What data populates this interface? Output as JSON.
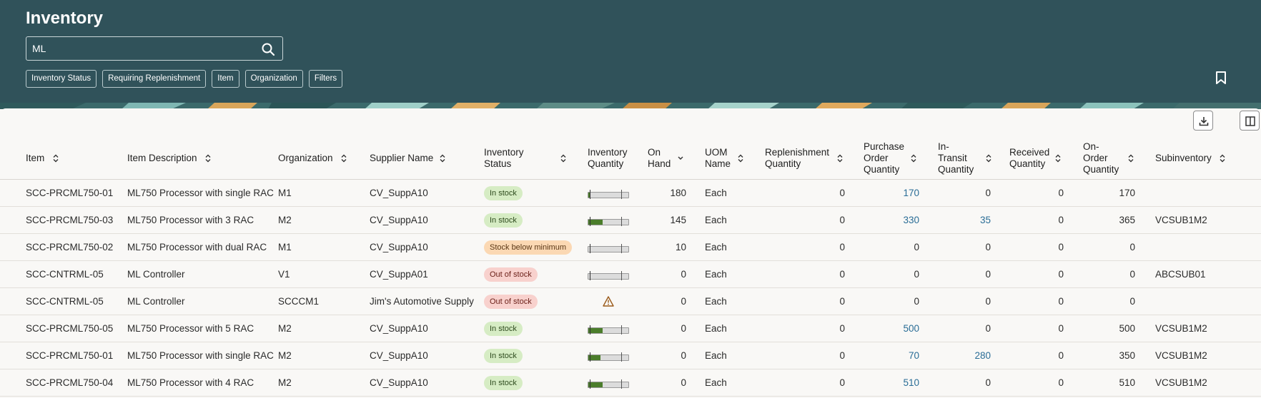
{
  "page": {
    "title": "Inventory"
  },
  "search": {
    "value": "ML"
  },
  "filters": [
    "Inventory Status",
    "Requiring Replenishment",
    "Item",
    "Organization",
    "Filters"
  ],
  "table": {
    "headers": {
      "item": [
        "Item"
      ],
      "description": [
        "Item Description"
      ],
      "organization": [
        "Organization"
      ],
      "supplier": [
        "Supplier Name"
      ],
      "status": [
        "Inventory",
        "Status"
      ],
      "inv_qty": [
        "Inventory",
        "Quantity"
      ],
      "on_hand": [
        "On",
        "Hand"
      ],
      "uom": [
        "UOM",
        "Name"
      ],
      "repl_qty": [
        "Replenishment",
        "Quantity"
      ],
      "po_qty": [
        "Purchase",
        "Order",
        "Quantity"
      ],
      "transit_qty": [
        "In-",
        "Transit",
        "Quantity"
      ],
      "received_qty": [
        "Received",
        "Quantity"
      ],
      "on_order_qty": [
        "On-",
        "Order",
        "Quantity"
      ],
      "subinventory": [
        "Subinventory"
      ]
    },
    "rows": [
      {
        "item": "SCC-PRCML750-01",
        "description": "ML750 Processor with single RAC",
        "organization": "M1",
        "supplier": "CV_SuppA10",
        "status": "In stock",
        "status_kind": "instock",
        "inv_qty_level": 0.06,
        "on_hand": "180",
        "uom": "Each",
        "repl_qty": "0",
        "po_qty": "170",
        "po_link": true,
        "transit_qty": "0",
        "transit_link": false,
        "received_qty": "0",
        "on_order_qty": "170",
        "subinventory": ""
      },
      {
        "item": "SCC-PRCML750-03",
        "description": "ML750 Processor with 3 RAC",
        "organization": "M2",
        "supplier": "CV_SuppA10",
        "status": "In stock",
        "status_kind": "instock",
        "inv_qty_level": 0.36,
        "on_hand": "145",
        "uom": "Each",
        "repl_qty": "0",
        "po_qty": "330",
        "po_link": true,
        "transit_qty": "35",
        "transit_link": true,
        "received_qty": "0",
        "on_order_qty": "365",
        "subinventory": "VCSUB1M2"
      },
      {
        "item": "SCC-PRCML750-02",
        "description": "ML750 Processor with dual RAC",
        "organization": "M1",
        "supplier": "CV_SuppA10",
        "status": "Stock below minimum",
        "status_kind": "below",
        "inv_qty_level": 0.0,
        "on_hand": "10",
        "uom": "Each",
        "repl_qty": "0",
        "po_qty": "0",
        "po_link": false,
        "transit_qty": "0",
        "transit_link": false,
        "received_qty": "0",
        "on_order_qty": "0",
        "subinventory": ""
      },
      {
        "item": "SCC-CNTRML-05",
        "description": "ML Controller",
        "organization": "V1",
        "supplier": "CV_SuppA01",
        "status": "Out of stock",
        "status_kind": "out",
        "inv_qty_level": 0.0,
        "on_hand": "0",
        "uom": "Each",
        "repl_qty": "0",
        "po_qty": "0",
        "po_link": false,
        "transit_qty": "0",
        "transit_link": false,
        "received_qty": "0",
        "on_order_qty": "0",
        "subinventory": "ABCSUB01"
      },
      {
        "item": "SCC-CNTRML-05",
        "description": "ML Controller",
        "organization": "SCCCM1",
        "supplier": "Jim's Automotive Supply",
        "status": "Out of stock",
        "status_kind": "out",
        "inv_qty_level": null,
        "on_hand": "0",
        "uom": "Each",
        "repl_qty": "0",
        "po_qty": "0",
        "po_link": false,
        "transit_qty": "0",
        "transit_link": false,
        "received_qty": "0",
        "on_order_qty": "0",
        "subinventory": ""
      },
      {
        "item": "SCC-PRCML750-05",
        "description": "ML750 Processor with 5 RAC",
        "organization": "M2",
        "supplier": "CV_SuppA10",
        "status": "In stock",
        "status_kind": "instock",
        "inv_qty_level": 0.36,
        "on_hand": "0",
        "uom": "Each",
        "repl_qty": "0",
        "po_qty": "500",
        "po_link": true,
        "transit_qty": "0",
        "transit_link": false,
        "received_qty": "0",
        "on_order_qty": "500",
        "subinventory": "VCSUB1M2"
      },
      {
        "item": "SCC-PRCML750-01",
        "description": "ML750 Processor with single RAC",
        "organization": "M2",
        "supplier": "CV_SuppA10",
        "status": "In stock",
        "status_kind": "instock",
        "inv_qty_level": 0.3,
        "on_hand": "0",
        "uom": "Each",
        "repl_qty": "0",
        "po_qty": "70",
        "po_link": true,
        "transit_qty": "280",
        "transit_link": true,
        "received_qty": "0",
        "on_order_qty": "350",
        "subinventory": "VCSUB1M2"
      },
      {
        "item": "SCC-PRCML750-04",
        "description": "ML750 Processor with 4 RAC",
        "organization": "M2",
        "supplier": "CV_SuppA10",
        "status": "In stock",
        "status_kind": "instock",
        "inv_qty_level": 0.36,
        "on_hand": "0",
        "uom": "Each",
        "repl_qty": "0",
        "po_qty": "510",
        "po_link": true,
        "transit_qty": "0",
        "transit_link": false,
        "received_qty": "0",
        "on_order_qty": "510",
        "subinventory": "VCSUB1M2"
      }
    ]
  },
  "colors": {
    "header_bg": "#30525a",
    "link": "#2a6d96",
    "bar_fill": "#4b7d2b"
  },
  "icons": {
    "search": "search-icon",
    "bookmark": "bookmark-icon",
    "export": "download-icon",
    "columns": "columns-icon",
    "sort": "sort-icon",
    "warning": "warning-icon"
  }
}
